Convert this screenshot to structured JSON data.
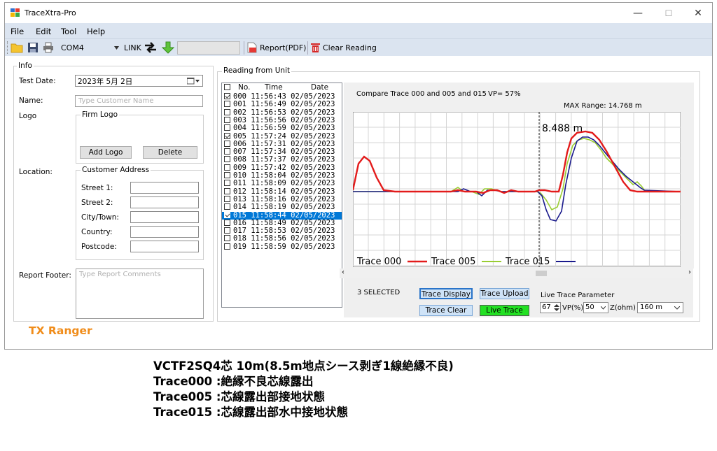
{
  "window": {
    "title": "TraceXtra-Pro",
    "minimize": "—",
    "maximize": "☐",
    "close": "✕"
  },
  "menu": [
    "File",
    "Edit",
    "Tool",
    "Help"
  ],
  "toolbar": {
    "port": "COM4",
    "link": "LINK",
    "report": "Report(PDF)",
    "clear": "Clear Reading"
  },
  "info": {
    "group": "Info",
    "test_date_label": "Test Date:",
    "test_date": "2023年 5月 2日",
    "name_label": "Name:",
    "name_placeholder": "Type Customer Name",
    "logo_label": "Logo",
    "firm_logo": "Firm Logo",
    "add_logo": "Add Logo",
    "delete": "Delete",
    "location_label": "Location:",
    "customer_address": "Customer Address",
    "street1": "Street 1:",
    "street2": "Street 2:",
    "city": "City/Town:",
    "country": "Country:",
    "postcode": "Postcode:",
    "report_footer_label": "Report Footer:",
    "report_footer_placeholder": "Type Report Comments"
  },
  "brand": "TX Ranger",
  "reading": {
    "group": "Reading from Unit",
    "col_no": "No.",
    "col_time": "Time",
    "col_date": "Date",
    "rows": [
      {
        "no": "000",
        "time": "11:56:43",
        "date": "02/05/2023",
        "checked": true,
        "selected": false
      },
      {
        "no": "001",
        "time": "11:56:49",
        "date": "02/05/2023",
        "checked": false,
        "selected": false
      },
      {
        "no": "002",
        "time": "11:56:53",
        "date": "02/05/2023",
        "checked": false,
        "selected": false
      },
      {
        "no": "003",
        "time": "11:56:56",
        "date": "02/05/2023",
        "checked": false,
        "selected": false
      },
      {
        "no": "004",
        "time": "11:56:59",
        "date": "02/05/2023",
        "checked": false,
        "selected": false
      },
      {
        "no": "005",
        "time": "11:57:24",
        "date": "02/05/2023",
        "checked": true,
        "selected": false
      },
      {
        "no": "006",
        "time": "11:57:31",
        "date": "02/05/2023",
        "checked": false,
        "selected": false
      },
      {
        "no": "007",
        "time": "11:57:34",
        "date": "02/05/2023",
        "checked": false,
        "selected": false
      },
      {
        "no": "008",
        "time": "11:57:37",
        "date": "02/05/2023",
        "checked": false,
        "selected": false
      },
      {
        "no": "009",
        "time": "11:57:42",
        "date": "02/05/2023",
        "checked": false,
        "selected": false
      },
      {
        "no": "010",
        "time": "11:58:04",
        "date": "02/05/2023",
        "checked": false,
        "selected": false
      },
      {
        "no": "011",
        "time": "11:58:09",
        "date": "02/05/2023",
        "checked": false,
        "selected": false
      },
      {
        "no": "012",
        "time": "11:58:14",
        "date": "02/05/2023",
        "checked": false,
        "selected": false
      },
      {
        "no": "013",
        "time": "11:58:16",
        "date": "02/05/2023",
        "checked": false,
        "selected": false
      },
      {
        "no": "014",
        "time": "11:58:19",
        "date": "02/05/2023",
        "checked": false,
        "selected": false
      },
      {
        "no": "015",
        "time": "11:58:44",
        "date": "02/05/2023",
        "checked": true,
        "selected": true
      },
      {
        "no": "016",
        "time": "11:58:49",
        "date": "02/05/2023",
        "checked": false,
        "selected": false
      },
      {
        "no": "017",
        "time": "11:58:53",
        "date": "02/05/2023",
        "checked": false,
        "selected": false
      },
      {
        "no": "018",
        "time": "11:58:56",
        "date": "02/05/2023",
        "checked": false,
        "selected": false
      },
      {
        "no": "019",
        "time": "11:58:59",
        "date": "02/05/2023",
        "checked": false,
        "selected": false
      }
    ]
  },
  "chart": {
    "compare_text": "Compare Trace 000 and 005 and 015",
    "vp_text": "VP= 57%",
    "max_range": "MAX Range: 14.768 m",
    "cursor_label": "8.488 m",
    "legend": [
      {
        "name": "Trace 000",
        "color": "#e31b1b"
      },
      {
        "name": "Trace 005",
        "color": "#9acd32"
      },
      {
        "name": "Trace 015",
        "color": "#1a1a8c"
      }
    ]
  },
  "controls": {
    "selected_count": "3 SELECTED",
    "trace_display": "Trace Display",
    "trace_upload": "Trace Upload",
    "trace_clear": "Trace Clear",
    "live_trace": "Live Trace",
    "live_param_label": "Live Trace Parameter",
    "vp_value": "67",
    "vp_unit": "VP(%)",
    "z_value": "50",
    "z_unit": "Z(ohm)",
    "range_value": "160 m"
  },
  "caption": [
    "VCTF2SQ4芯 10m(8.5m地点シース剥ぎ1線絶縁不良)",
    "Trace000 :絶縁不良芯線露出",
    "Trace005 :芯線露出部接地状態",
    "Trace015 :芯線露出部水中接地状態"
  ]
}
